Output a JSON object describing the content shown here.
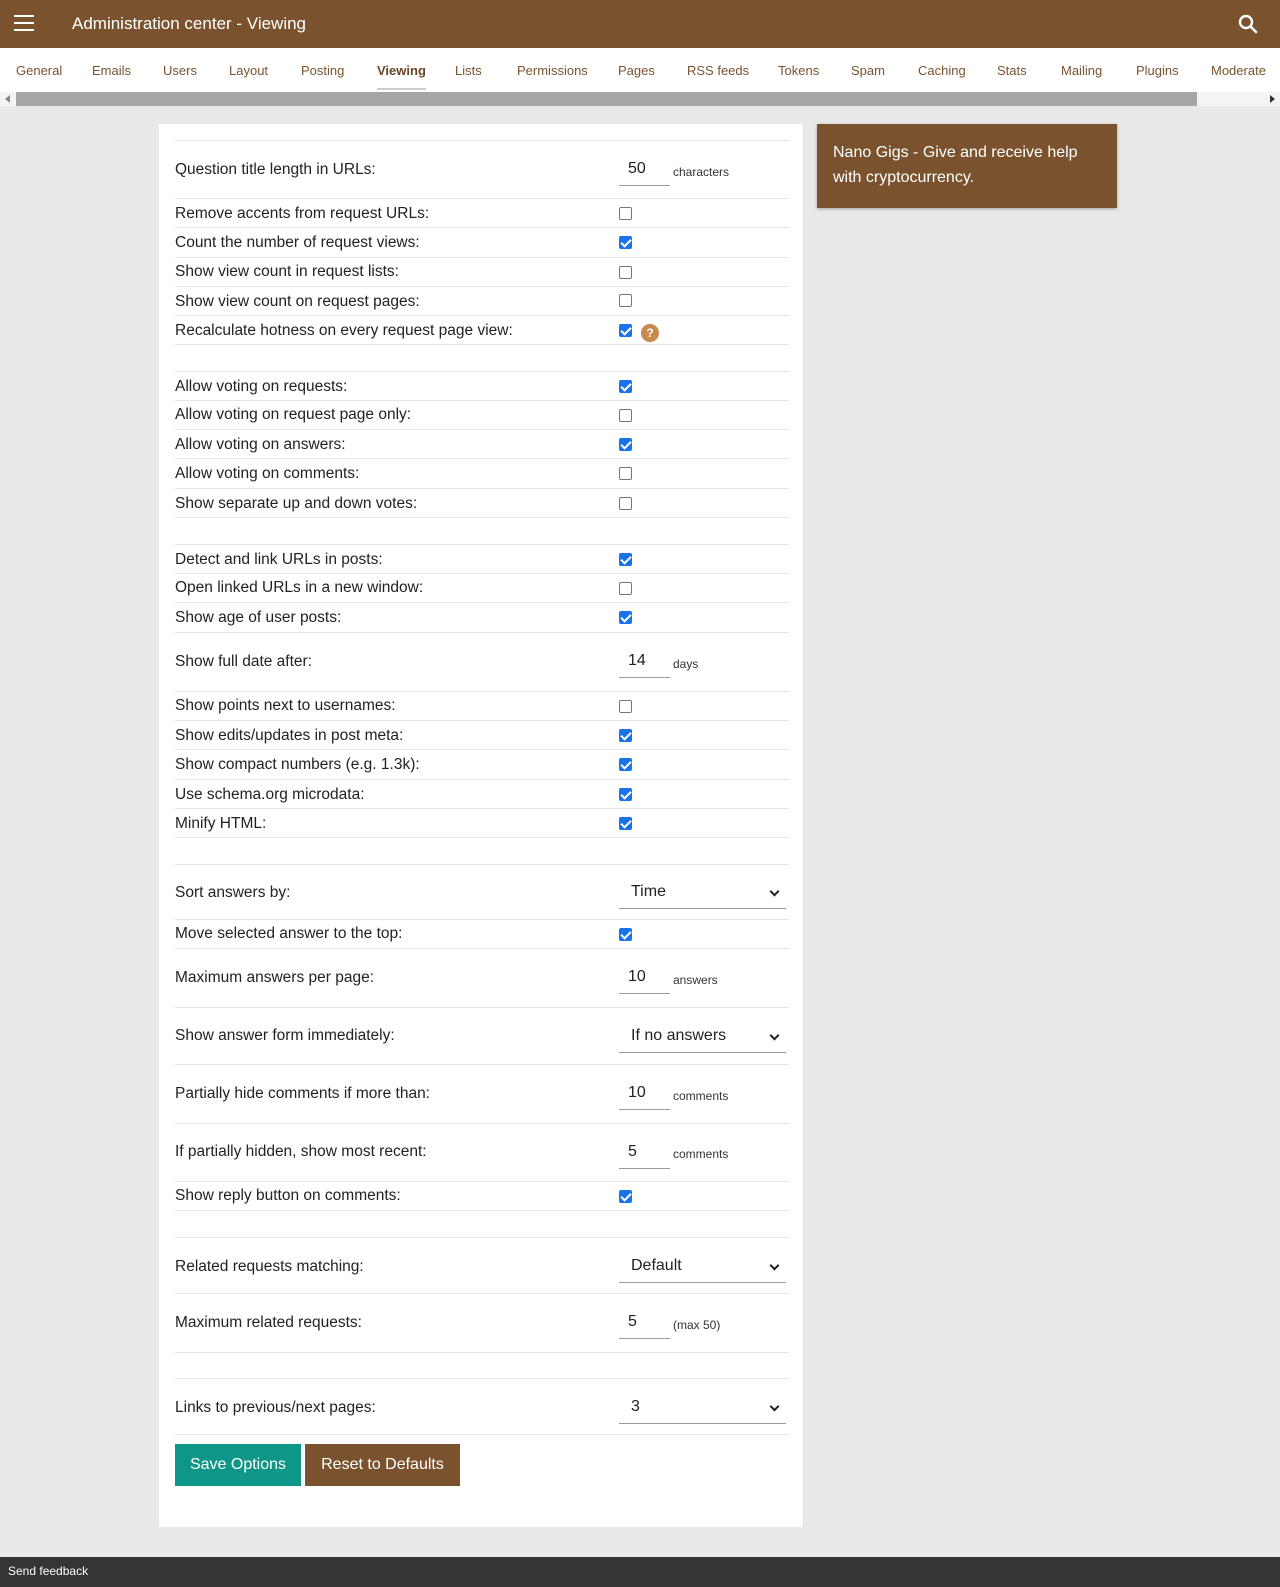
{
  "header": {
    "title": "Administration center - Viewing"
  },
  "tabs": [
    {
      "label": "General"
    },
    {
      "label": "Emails"
    },
    {
      "label": "Users"
    },
    {
      "label": "Layout"
    },
    {
      "label": "Posting"
    },
    {
      "label": "Viewing"
    },
    {
      "label": "Lists"
    },
    {
      "label": "Permissions"
    },
    {
      "label": "Pages"
    },
    {
      "label": "RSS feeds"
    },
    {
      "label": "Tokens"
    },
    {
      "label": "Spam"
    },
    {
      "label": "Caching"
    },
    {
      "label": "Stats"
    },
    {
      "label": "Mailing"
    },
    {
      "label": "Plugins"
    },
    {
      "label": "Moderate"
    }
  ],
  "active_tab": "Viewing",
  "options": {
    "title_length": {
      "label": "Question title length in URLs:",
      "value": "50",
      "unit": "characters"
    },
    "remove_accents": {
      "label": "Remove accents from request URLs:",
      "checked": false
    },
    "count_views": {
      "label": "Count the number of request views:",
      "checked": true
    },
    "view_count_lists": {
      "label": "Show view count in request lists:",
      "checked": false
    },
    "view_count_pages": {
      "label": "Show view count on request pages:",
      "checked": false
    },
    "recalc_hotness": {
      "label": "Recalculate hotness on every request page view:",
      "checked": true,
      "help": "?"
    },
    "vote_requests": {
      "label": "Allow voting on requests:",
      "checked": true
    },
    "vote_request_page": {
      "label": "Allow voting on request page only:",
      "checked": false
    },
    "vote_answers": {
      "label": "Allow voting on answers:",
      "checked": true
    },
    "vote_comments": {
      "label": "Allow voting on comments:",
      "checked": false
    },
    "separate_votes": {
      "label": "Show separate up and down votes:",
      "checked": false
    },
    "link_urls": {
      "label": "Detect and link URLs in posts:",
      "checked": true
    },
    "new_window": {
      "label": "Open linked URLs in a new window:",
      "checked": false
    },
    "show_age": {
      "label": "Show age of user posts:",
      "checked": true
    },
    "full_date": {
      "label": "Show full date after:",
      "value": "14",
      "unit": "days"
    },
    "points_names": {
      "label": "Show points next to usernames:",
      "checked": false
    },
    "edits_meta": {
      "label": "Show edits/updates in post meta:",
      "checked": true
    },
    "compact_numbers": {
      "label": "Show compact numbers (e.g. 1.3k):",
      "checked": true
    },
    "schema_org": {
      "label": "Use schema.org microdata:",
      "checked": true
    },
    "minify_html": {
      "label": "Minify HTML:",
      "checked": true
    },
    "sort_answers": {
      "label": "Sort answers by:",
      "value": "Time"
    },
    "selected_top": {
      "label": "Move selected answer to the top:",
      "checked": true
    },
    "max_answers": {
      "label": "Maximum answers per page:",
      "value": "10",
      "unit": "answers"
    },
    "answer_form": {
      "label": "Show answer form immediately:",
      "value": "If no answers"
    },
    "hide_comments": {
      "label": "Partially hide comments if more than:",
      "value": "10",
      "unit": "comments"
    },
    "show_recent": {
      "label": "If partially hidden, show most recent:",
      "value": "5",
      "unit": "comments"
    },
    "reply_button": {
      "label": "Show reply button on comments:",
      "checked": true
    },
    "related_matching": {
      "label": "Related requests matching:",
      "value": "Default"
    },
    "max_related": {
      "label": "Maximum related requests:",
      "value": "5",
      "unit": "(max 50)"
    },
    "prev_next_links": {
      "label": "Links to previous/next pages:",
      "value": "3"
    }
  },
  "buttons": {
    "save": "Save Options",
    "reset": "Reset to Defaults"
  },
  "sidebar_ad": {
    "text": "Nano Gigs - Give and receive help with cryptocurrency."
  },
  "footer": {
    "feedback": "Send feedback"
  },
  "colors": {
    "brand": "#7a532e",
    "save": "#0e9688",
    "checkbox": "#1a73e8",
    "help": "#c8894e"
  }
}
